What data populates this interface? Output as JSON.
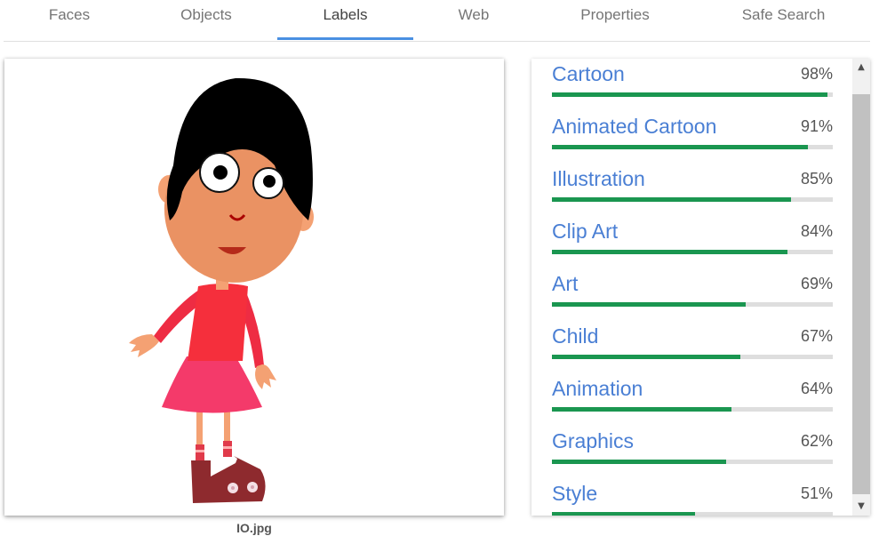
{
  "tabs": [
    {
      "label": "Faces"
    },
    {
      "label": "Objects"
    },
    {
      "label": "Labels",
      "active": true
    },
    {
      "label": "Web"
    },
    {
      "label": "Properties"
    },
    {
      "label": "Safe Search"
    }
  ],
  "image": {
    "filename": "IO.jpg"
  },
  "labels": [
    {
      "name": "Cartoon",
      "score_text": "98%",
      "score": 0.98
    },
    {
      "name": "Animated Cartoon",
      "score_text": "91%",
      "score": 0.91
    },
    {
      "name": "Illustration",
      "score_text": "85%",
      "score": 0.85
    },
    {
      "name": "Clip Art",
      "score_text": "84%",
      "score": 0.84
    },
    {
      "name": "Art",
      "score_text": "69%",
      "score": 0.69
    },
    {
      "name": "Child",
      "score_text": "67%",
      "score": 0.67
    },
    {
      "name": "Animation",
      "score_text": "64%",
      "score": 0.64
    },
    {
      "name": "Graphics",
      "score_text": "62%",
      "score": 0.62
    },
    {
      "name": "Style",
      "score_text": "51%",
      "score": 0.51
    }
  ],
  "colors": {
    "accent": "#4a90e2",
    "label_text": "#4a7fd4",
    "bar_fill": "#1a9650",
    "bar_bg": "#dedede"
  },
  "icons": {
    "scroll_up": "chevron-up-icon",
    "scroll_down": "chevron-down-icon"
  }
}
